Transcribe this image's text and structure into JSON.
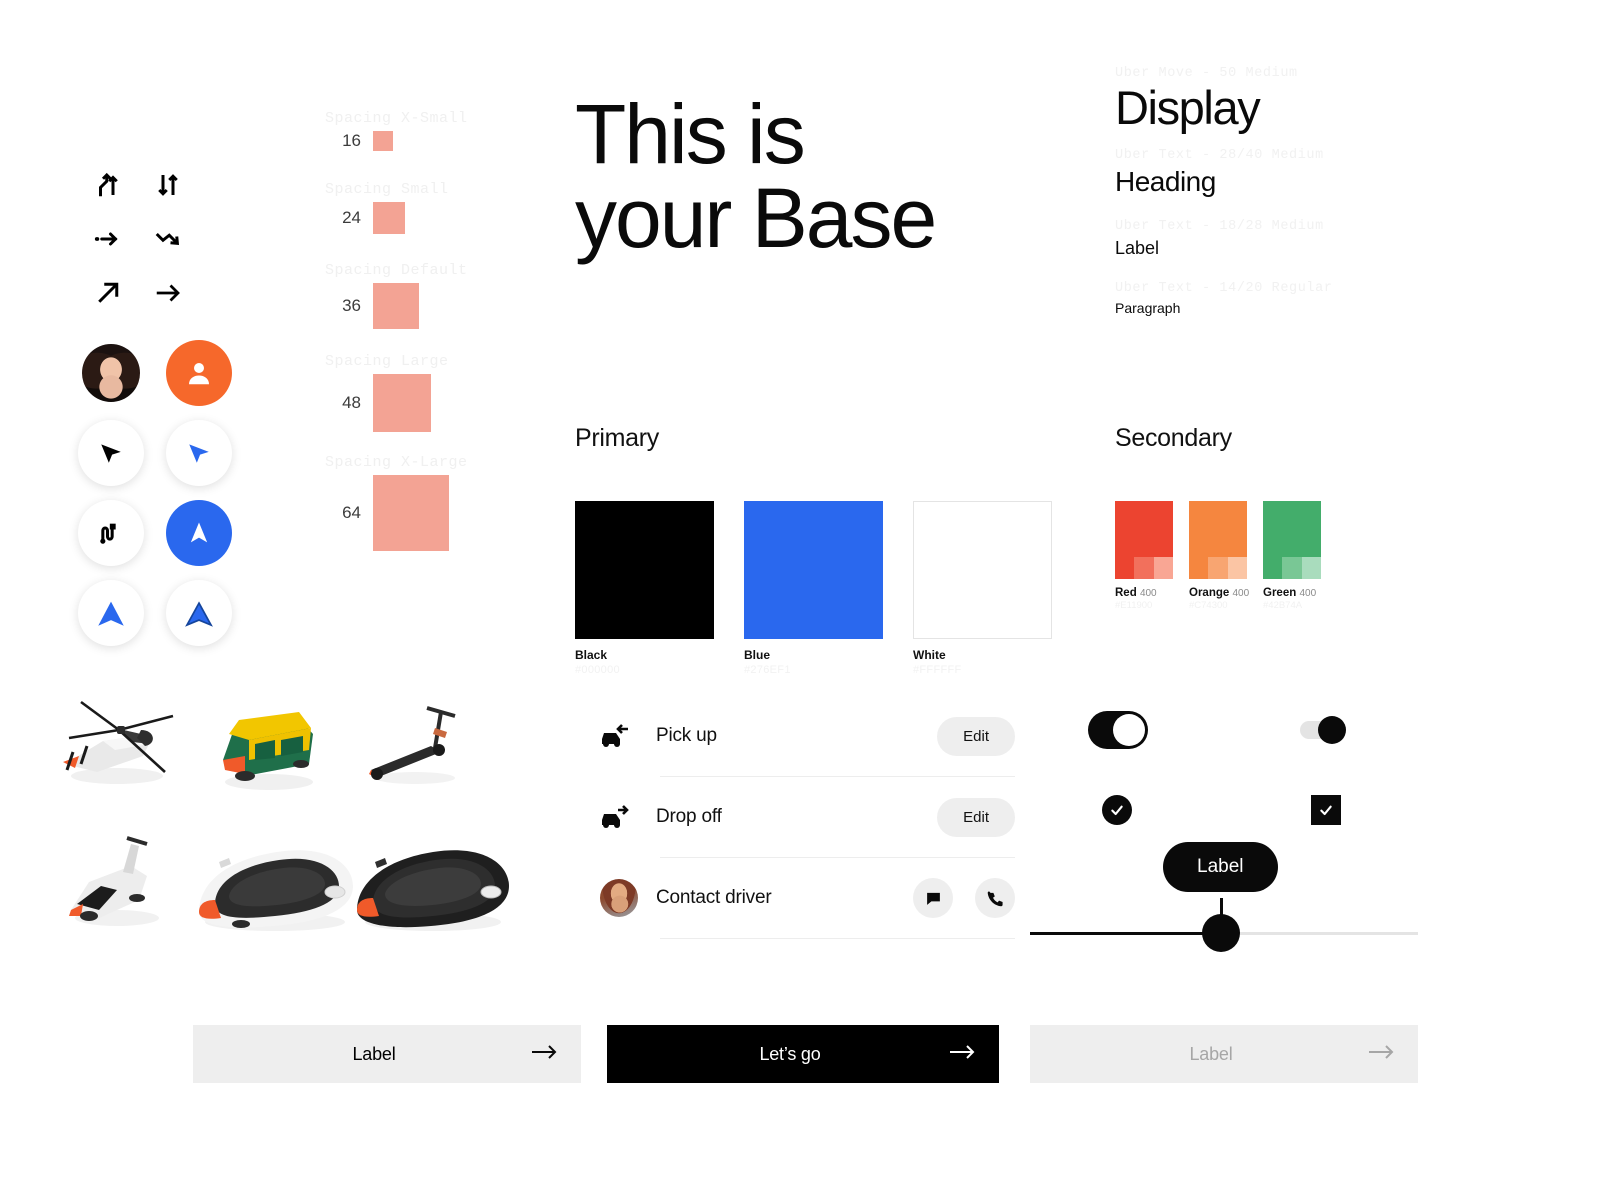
{
  "hero": {
    "line1": "This is",
    "line2": "your Base"
  },
  "spacing": {
    "items": [
      {
        "caption": "Spacing X-Small",
        "value": "16",
        "size": 20
      },
      {
        "caption": "Spacing Small",
        "value": "24",
        "size": 32
      },
      {
        "caption": "Spacing Default",
        "value": "36",
        "size": 46
      },
      {
        "caption": "Spacing Large",
        "value": "48",
        "size": 58
      },
      {
        "caption": "Spacing X-Large",
        "value": "64",
        "size": 76
      }
    ]
  },
  "typography": {
    "specs": [
      "Uber Move - 50 Medium",
      "Uber Text - 28/40 Medium",
      "Uber Text - 18/28 Medium",
      "Uber Text - 14/20 Regular"
    ],
    "samples": [
      "Display",
      "Heading",
      "Label",
      "Paragraph"
    ]
  },
  "colors": {
    "primary_title": "Primary",
    "secondary_title": "Secondary",
    "primary": [
      {
        "name": "Black",
        "hex": "#000000",
        "swatch": "#000000"
      },
      {
        "name": "Blue",
        "hex": "#276EF1",
        "swatch": "#2a68ee"
      },
      {
        "name": "White",
        "hex": "#FFFFFF",
        "swatch": "#ffffff"
      }
    ],
    "secondary": [
      {
        "name": "Red",
        "step": "400",
        "hex": "#E11900",
        "swatch": "#ec4430",
        "t1": "#f2705c",
        "t2": "#f9a694"
      },
      {
        "name": "Orange",
        "step": "400",
        "hex": "#C74300",
        "swatch": "#f5863f",
        "t1": "#f8a571",
        "t2": "#fbc5a4"
      },
      {
        "name": "Green",
        "step": "400",
        "hex": "#42B74A",
        "swatch": "#43ad6b",
        "t1": "#79c795",
        "t2": "#a9dcbd"
      }
    ]
  },
  "ride_list": {
    "rows": [
      {
        "label": "Pick up",
        "icon": "car-pickup-icon",
        "action": "Edit"
      },
      {
        "label": "Drop off",
        "icon": "car-dropoff-icon",
        "action": "Edit"
      },
      {
        "label": "Contact driver",
        "icon": "driver-avatar",
        "action": ""
      }
    ]
  },
  "slider": {
    "tooltip": "Label"
  },
  "buttons": {
    "secondary": {
      "label": "Label",
      "arrow": "arrow-right-icon"
    },
    "primary": {
      "label": "Let’s go",
      "arrow": "arrow-right-icon"
    },
    "disabled": {
      "label": "Label",
      "arrow": "arrow-right-icon"
    }
  },
  "icons": {
    "arrows": [
      "merge-up-icon",
      "up-down-icon",
      "dotted-arrow-right-icon",
      "zigzag-down-icon",
      "arrow-up-right-icon",
      "arrow-right-icon"
    ],
    "avatars": [
      "user-photo-avatar",
      "user-placeholder-avatar"
    ],
    "navigation": [
      "navigation-arrow-black-icon",
      "navigation-arrow-blue-icon",
      "route-icon",
      "navigation-filled-blue-icon",
      "chevron-up-blue-icon",
      "chevron-up-outline-blue-icon"
    ],
    "vehicles": [
      "helicopter-3d",
      "auto-rickshaw-3d",
      "e-scooter-3d",
      "moped-3d",
      "white-car-3d",
      "black-car-3d"
    ]
  }
}
